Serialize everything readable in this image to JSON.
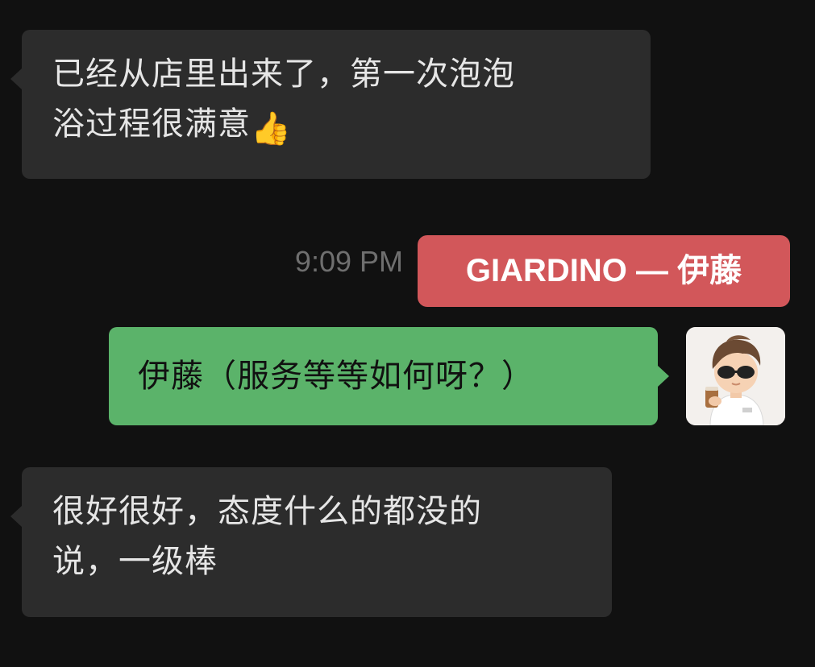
{
  "messages": {
    "incoming_1": {
      "line1": "已经从店里出来了，第一次泡泡",
      "line2": "浴过程很满意",
      "emoji": "👍"
    },
    "outgoing_1": {
      "text": "伊藤（服务等等如何呀？）"
    },
    "incoming_2": {
      "line1": "很好很好，态度什么的都没的",
      "line2": "说，一级棒"
    }
  },
  "timestamp": "9:09 PM",
  "tag": {
    "label": "GIARDINO — 伊藤",
    "color": "#d2575a"
  },
  "colors": {
    "background": "#111111",
    "incoming_bubble": "#2c2c2c",
    "outgoing_bubble": "#5bb36a"
  },
  "icons": {
    "emoji": "thumbs-up-icon",
    "avatar": "avatar-boy-sunglasses"
  }
}
